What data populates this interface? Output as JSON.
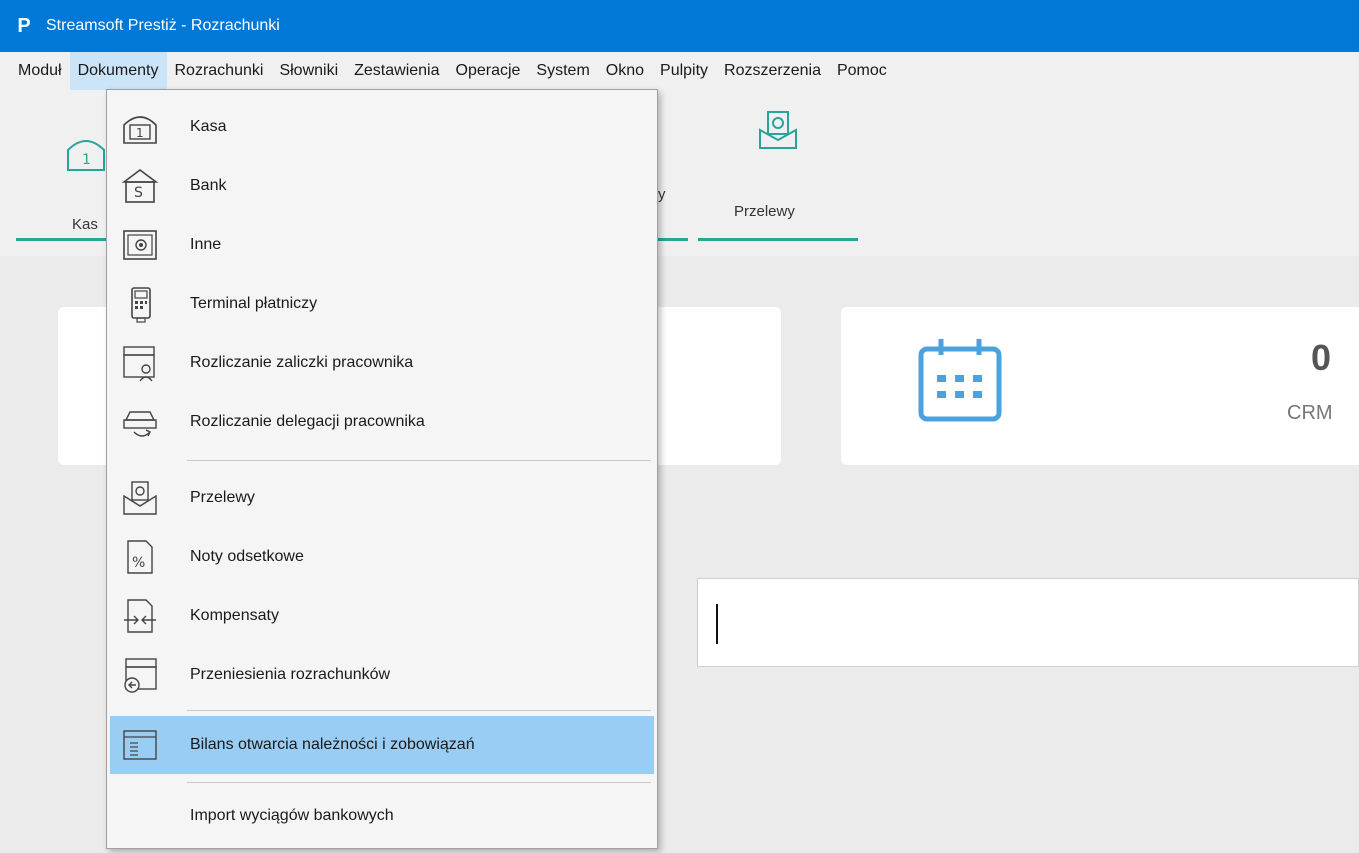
{
  "window": {
    "title": "Streamsoft Prestiż - Rozrachunki",
    "logo_letter": "P"
  },
  "menubar": [
    {
      "label": "Moduł",
      "active": false
    },
    {
      "label": "Dokumenty",
      "active": true
    },
    {
      "label": "Rozrachunki",
      "active": false
    },
    {
      "label": "Słowniki",
      "active": false
    },
    {
      "label": "Zestawienia",
      "active": false
    },
    {
      "label": "Operacje",
      "active": false
    },
    {
      "label": "System",
      "active": false
    },
    {
      "label": "Okno",
      "active": false
    },
    {
      "label": "Pulpity",
      "active": false
    },
    {
      "label": "Rozszerzenia",
      "active": false
    },
    {
      "label": "Pomoc",
      "active": false
    }
  ],
  "toolbar": {
    "kasa_label_partial": "Kas",
    "przelewy_label": "Przelewy",
    "partial_char": "y"
  },
  "stats": {
    "crm_value": "0",
    "crm_label": "CRM"
  },
  "dropdown": {
    "items": [
      {
        "label": "Kasa",
        "icon": "cash-register-icon"
      },
      {
        "label": "Bank",
        "icon": "bank-icon"
      },
      {
        "label": "Inne",
        "icon": "safe-icon"
      },
      {
        "label": "Terminal płatniczy",
        "icon": "payment-terminal-icon"
      },
      {
        "label": "Rozliczanie zaliczki pracownika",
        "icon": "advance-settlement-icon"
      },
      {
        "label": "Rozliczanie delegacji pracownika",
        "icon": "business-trip-icon"
      },
      {
        "label": "Przelewy",
        "icon": "transfer-envelope-icon"
      },
      {
        "label": "Noty odsetkowe",
        "icon": "interest-note-icon"
      },
      {
        "label": "Kompensaty",
        "icon": "compensation-icon"
      },
      {
        "label": "Przeniesienia rozrachunków",
        "icon": "settlement-transfer-icon"
      },
      {
        "label": "Bilans otwarcia należności i zobowiązań",
        "icon": "opening-balance-icon"
      },
      {
        "label": "Import wyciągów bankowych",
        "icon": ""
      }
    ]
  },
  "colors": {
    "titlebar": "#0078d7",
    "accent": "#26a69a",
    "highlight": "#99cdf3",
    "icon_blue": "#4aa3df"
  }
}
